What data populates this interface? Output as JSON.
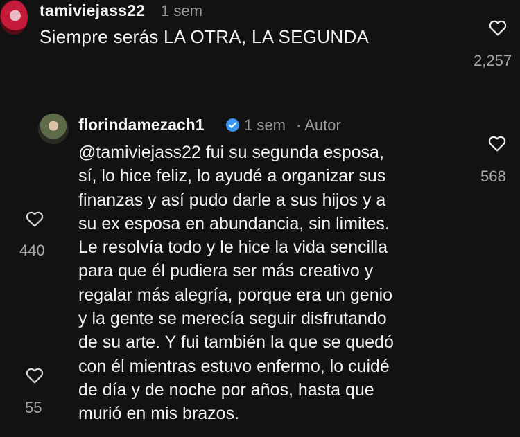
{
  "top_comment": {
    "username": "tamiviejass22",
    "time": "1 sem",
    "text": "Siempre serás LA OTRA, LA SEGUNDA",
    "likes": "2,257"
  },
  "reply": {
    "username": "florindamezach1",
    "time": "1 sem",
    "author_tag": "· Autor",
    "likes": "568",
    "lines": [
      "@tamiviejass22 fui su segunda esposa,",
      "sí, lo hice feliz, lo ayudé a organizar  sus",
      "finanzas y así pudo darle a sus hijos y a",
      "su ex esposa en abundancia, sin limites.",
      "Le resolvía todo y le hice la vida sencilla",
      "para que él pudiera ser más creativo y",
      "regalar más alegría, porque  era un genio",
      "y la gente se merecía  seguir disfrutando",
      "de su arte.  Y fui también la que se quedó",
      "con él mientras estuvo enfermo, lo cuidé",
      "de día y de noche por años, hasta que",
      "murió en mis brazos."
    ]
  },
  "side_likes": {
    "first": "440",
    "second": "55"
  },
  "icons": {
    "heart": "heart-outline-icon",
    "verified": "verified-badge-icon"
  },
  "colors": {
    "background": "#121212",
    "text": "#f5f5f5",
    "muted": "#9a9a9a",
    "verified": "#3897f0"
  }
}
